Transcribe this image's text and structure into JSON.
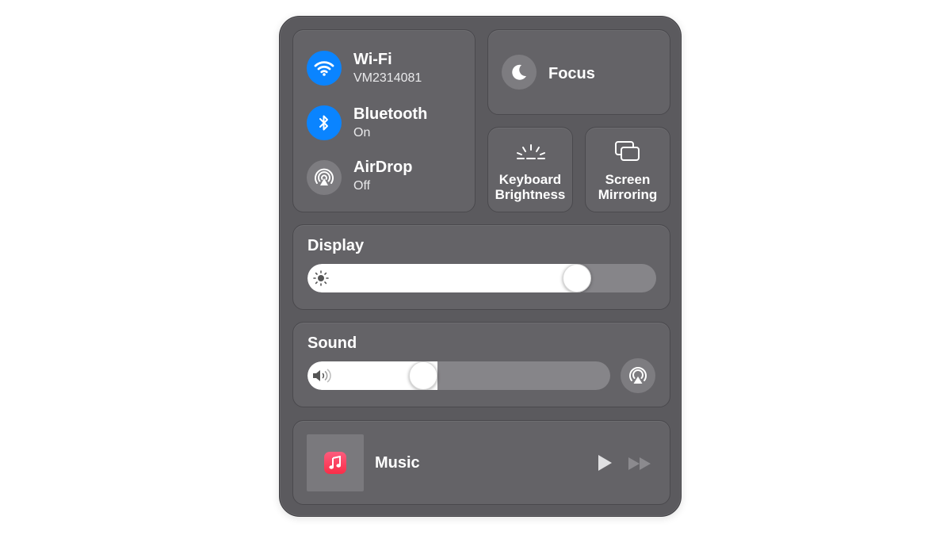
{
  "connectivity": {
    "wifi": {
      "title": "Wi-Fi",
      "subtitle": "VM2314081",
      "icon": "wifi-icon"
    },
    "bluetooth": {
      "title": "Bluetooth",
      "subtitle": "On",
      "icon": "bluetooth-icon"
    },
    "airdrop": {
      "title": "AirDrop",
      "subtitle": "Off",
      "icon": "airdrop-icon"
    }
  },
  "focus": {
    "label": "Focus",
    "icon": "moon-icon"
  },
  "keyboard_brightness": {
    "line1": "Keyboard",
    "line2": "Brightness",
    "icon": "keyboard-brightness-icon"
  },
  "screen_mirroring": {
    "line1": "Screen",
    "line2": "Mirroring",
    "icon": "screen-mirroring-icon"
  },
  "display": {
    "label": "Display",
    "level": 0.77,
    "icon": "sun-icon"
  },
  "sound": {
    "label": "Sound",
    "level": 0.38,
    "icon": "speaker-icon",
    "airplay_icon": "airplay-audio-icon"
  },
  "now_playing": {
    "label": "Music",
    "icons": [
      "music-app-icon",
      "play-icon",
      "fast-forward-icon"
    ]
  },
  "colors": {
    "accent": "#0a84ff",
    "panel": "#5b5a5e",
    "tile": "#646367",
    "music_red": "#fa2d48"
  }
}
